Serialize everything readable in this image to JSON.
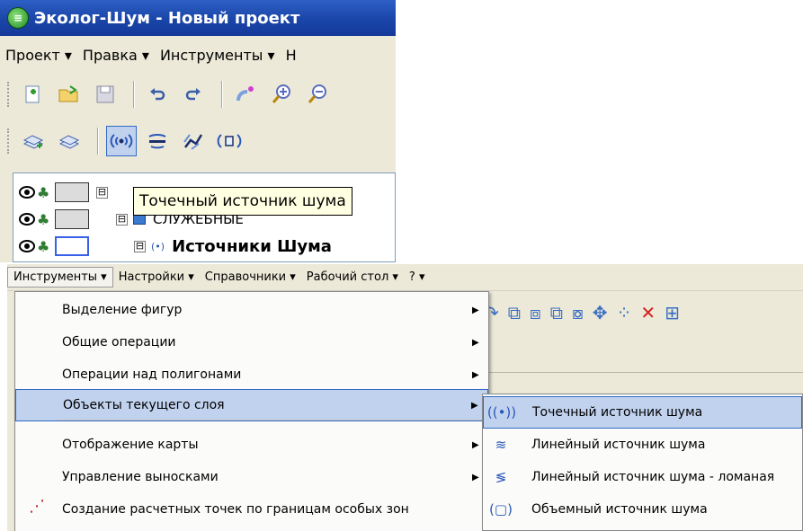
{
  "window": {
    "title": "Эколог-Шум - Новый проект",
    "logo_glyph": "≡"
  },
  "menubar": {
    "items": [
      "Проект ▾",
      "Правка ▾",
      "Инструменты ▾",
      "Н"
    ]
  },
  "toolbar1": {
    "icons": [
      "new-project-icon",
      "open-folder-icon",
      "save-icon",
      "undo-icon",
      "redo-icon",
      "select-hand-icon",
      "zoom-in-icon",
      "zoom-out-icon"
    ]
  },
  "toolbar2": {
    "icons": [
      "add-layer-icon",
      "layer-icon",
      "point-source-icon",
      "linear-source-icon",
      "polyline-source-icon",
      "volume-source-icon"
    ]
  },
  "tooltip": {
    "text": "Точечный источник шума"
  },
  "layer_tree": {
    "rows": [
      {
        "label": "",
        "expander": "⊟"
      },
      {
        "label": "СЛУЖЕБНЫЕ",
        "expander": "⊟"
      },
      {
        "label": "Источники Шума",
        "expander": "⊟",
        "icon_glyph": "(•)"
      }
    ]
  },
  "bottom_menubar": {
    "items": [
      "Инструменты ▾",
      "Настройки ▾",
      "Справочники ▾",
      "Рабочий стол ▾",
      "?  ▾"
    ]
  },
  "tools_menu": {
    "items": [
      {
        "label": "Выделение фигур",
        "has_submenu": true
      },
      {
        "label": "Общие операции",
        "has_submenu": true
      },
      {
        "label": "Операции над полигонами",
        "has_submenu": true
      },
      {
        "label": "Объекты текущего слоя",
        "has_submenu": true,
        "highlighted": true
      },
      {
        "label": "Отображение карты",
        "has_submenu": true
      },
      {
        "label": "Управление выносками",
        "has_submenu": true
      },
      {
        "label": "Создание расчетных точек по границам особых зон",
        "has_submenu": false
      }
    ]
  },
  "submenu": {
    "items": [
      {
        "label": "Точечный источник шума",
        "icon": "point-source-icon",
        "glyph": "((•))",
        "highlighted": true
      },
      {
        "label": "Линейный источник шума",
        "icon": "linear-source-icon",
        "glyph": "≋"
      },
      {
        "label": "Линейный источник шума - ломаная",
        "icon": "polyline-source-icon",
        "glyph": "≶"
      },
      {
        "label": "Объемный источник шума",
        "icon": "volume-source-icon",
        "glyph": "(▢)"
      }
    ]
  },
  "colors": {
    "title_bar": "#1a45a8",
    "highlight": "#c1d2ee",
    "highlight_border": "#316ac5",
    "menu_bg": "#ece9d8"
  }
}
